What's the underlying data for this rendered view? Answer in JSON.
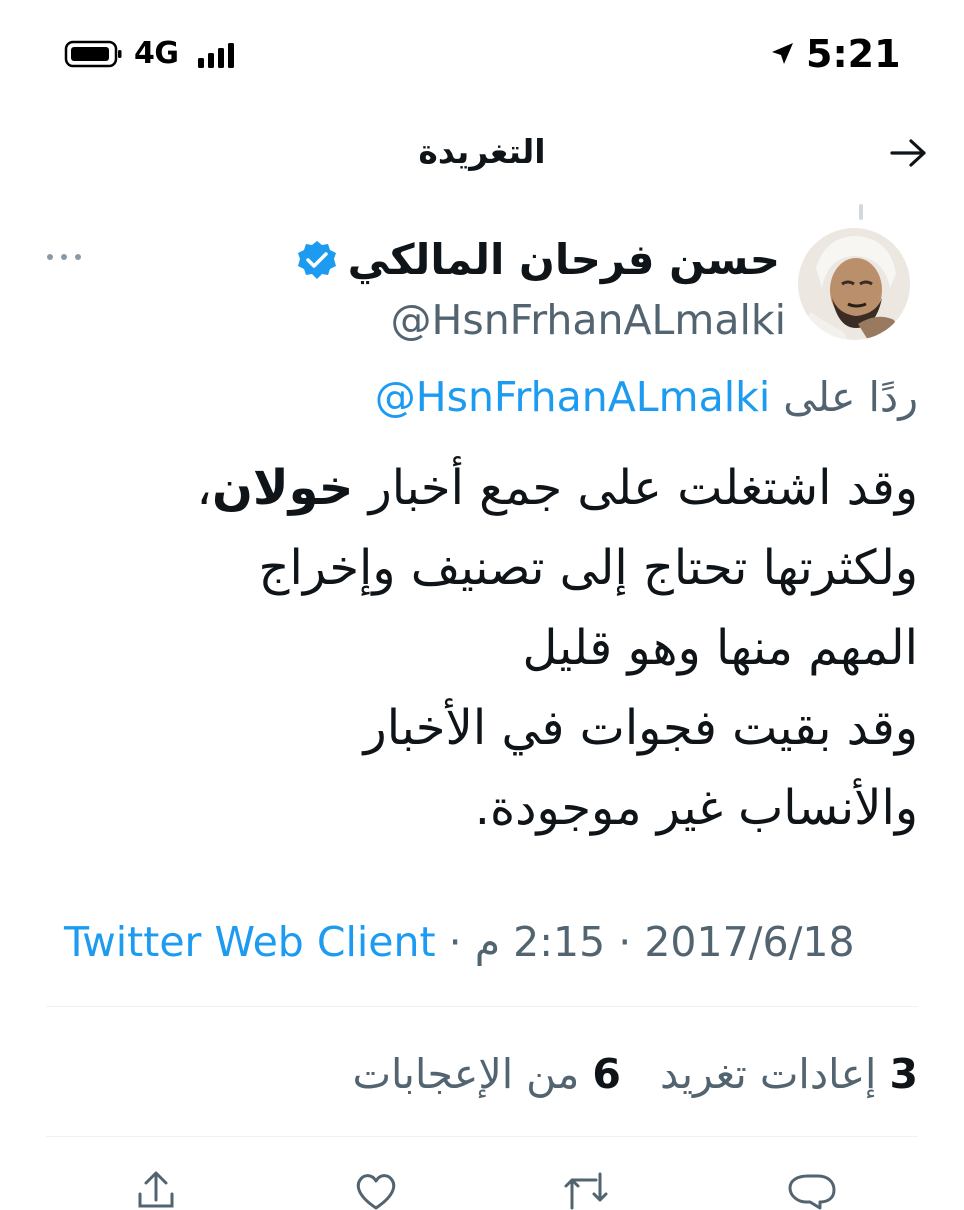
{
  "status_bar": {
    "network": "4G",
    "time": "5:21",
    "icons": [
      "battery-icon",
      "signal-icon",
      "location-arrow-icon"
    ]
  },
  "header": {
    "title": "التغريدة",
    "back_icon": "arrow-right-icon"
  },
  "tweet": {
    "author_name": "حسن فرحان المالكي",
    "verified": true,
    "handle": "@HsnFrhanALmalki",
    "reply_prefix": "ردًا على",
    "reply_to": "@HsnFrhanALmalki",
    "body": {
      "line1_start": "وقد اشتغلت على جمع أخبار ",
      "line1_bold": "خولان",
      "line1_end": "،",
      "rest": "ولكثرتها تحتاج إلى تصنيف وإخراج\nالمهم منها وهو قليل\nوقد بقيت فجوات في الأخبار\nوالأنساب غير موجودة."
    },
    "date": "2017/6/18",
    "separator": "·",
    "time": "2:15 م",
    "source": "Twitter Web Client",
    "stats": {
      "retweets_count": "3",
      "retweets_label": "إعادات تغريد",
      "likes_count": "6",
      "likes_label": "من الإعجابات"
    },
    "actions": [
      "reply-icon",
      "retweet-icon",
      "like-icon",
      "share-icon"
    ]
  },
  "colors": {
    "text": "#0f1419",
    "secondary": "#536471",
    "link": "#1d9bf0",
    "divider": "#eff3f4"
  }
}
